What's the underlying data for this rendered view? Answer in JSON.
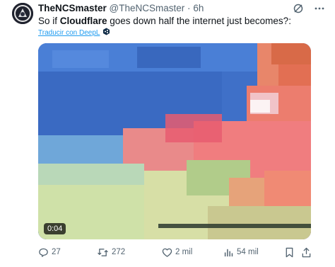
{
  "tweet": {
    "display_name": "TheNCSmaster",
    "handle": "@TheNCSmaster",
    "separator": "·",
    "time": "6h",
    "text_prefix": "So if ",
    "text_bold": "Cloudflare",
    "text_suffix": " goes down half the internet just becomes?:",
    "translate_label": "Traducir con DeepL"
  },
  "media": {
    "video_time": "0:04"
  },
  "actions": {
    "replies": "27",
    "reposts": "272",
    "likes": "2 mil",
    "views": "54 mil"
  },
  "colors": {
    "link": "#1d9bf0",
    "secondary_text": "#536471",
    "primary_text": "#0f1419"
  },
  "icons": [
    "grok-icon",
    "more-icon",
    "deepl-badge-icon",
    "reply-icon",
    "repost-icon",
    "like-icon",
    "views-icon",
    "bookmark-icon",
    "share-icon"
  ]
}
